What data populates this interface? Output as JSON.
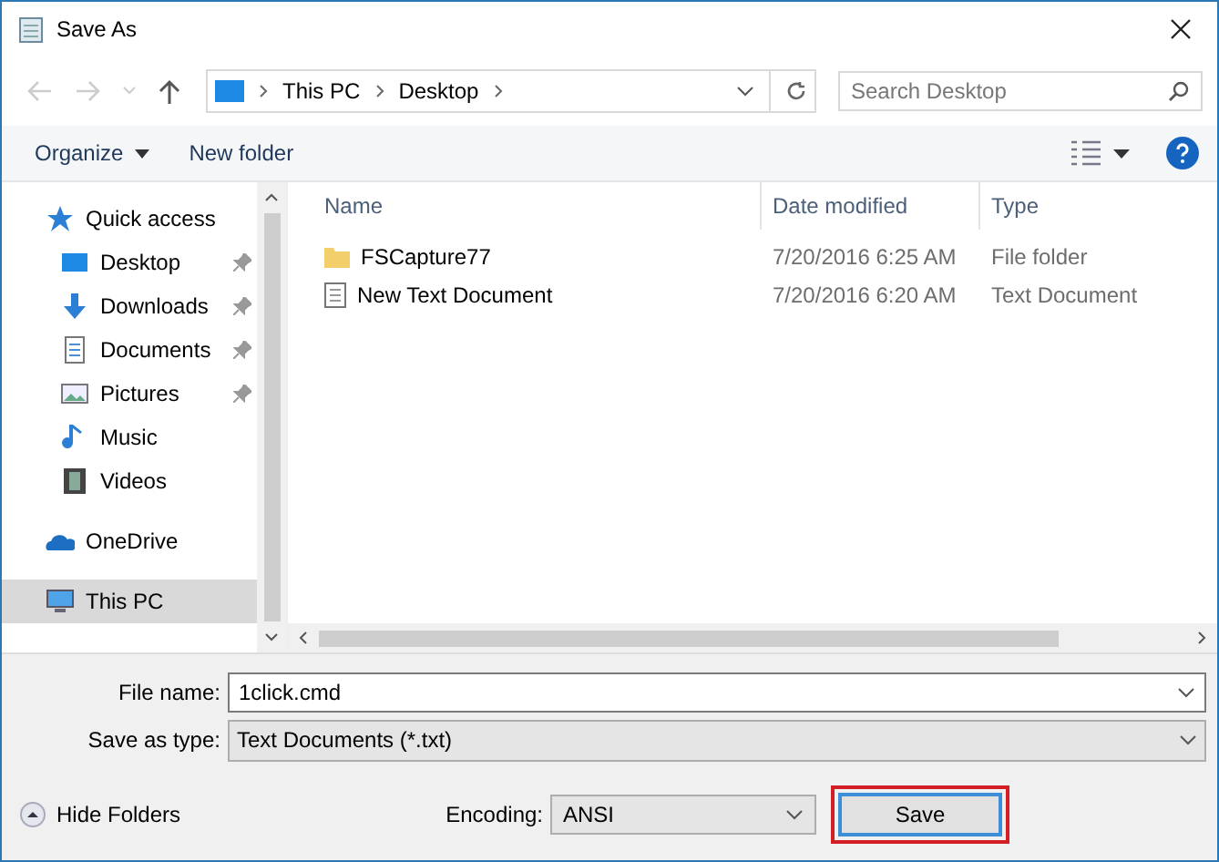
{
  "window": {
    "title": "Save As"
  },
  "address": {
    "path": [
      "This PC",
      "Desktop"
    ]
  },
  "search": {
    "placeholder": "Search Desktop"
  },
  "toolbar": {
    "organize": "Organize",
    "new_folder": "New folder"
  },
  "sidebar": {
    "items": [
      {
        "label": "Quick access",
        "kind": "quick",
        "pinned": false,
        "selected": false
      },
      {
        "label": "Desktop",
        "kind": "desktop",
        "pinned": true,
        "selected": false
      },
      {
        "label": "Downloads",
        "kind": "downloads",
        "pinned": true,
        "selected": false
      },
      {
        "label": "Documents",
        "kind": "documents",
        "pinned": true,
        "selected": false
      },
      {
        "label": "Pictures",
        "kind": "pictures",
        "pinned": true,
        "selected": false
      },
      {
        "label": "Music",
        "kind": "music",
        "pinned": false,
        "selected": false
      },
      {
        "label": "Videos",
        "kind": "videos",
        "pinned": false,
        "selected": false
      },
      {
        "label": "OneDrive",
        "kind": "cloud",
        "pinned": false,
        "selected": false
      },
      {
        "label": "This PC",
        "kind": "pc",
        "pinned": false,
        "selected": true
      }
    ]
  },
  "table": {
    "columns": [
      "Name",
      "Date modified",
      "Type"
    ],
    "rows": [
      {
        "kind": "folder",
        "name": "FSCapture77",
        "date": "7/20/2016 6:25 AM",
        "type": "File folder"
      },
      {
        "kind": "text",
        "name": "New Text Document",
        "date": "7/20/2016 6:20 AM",
        "type": "Text Document"
      }
    ]
  },
  "form": {
    "file_name_label": "File name:",
    "file_name": "1click.cmd",
    "type_label": "Save as type:",
    "type": "Text Documents (*.txt)"
  },
  "footer": {
    "hide_folders": "Hide Folders",
    "encoding_label": "Encoding:",
    "encoding": "ANSI",
    "save": "Save"
  }
}
